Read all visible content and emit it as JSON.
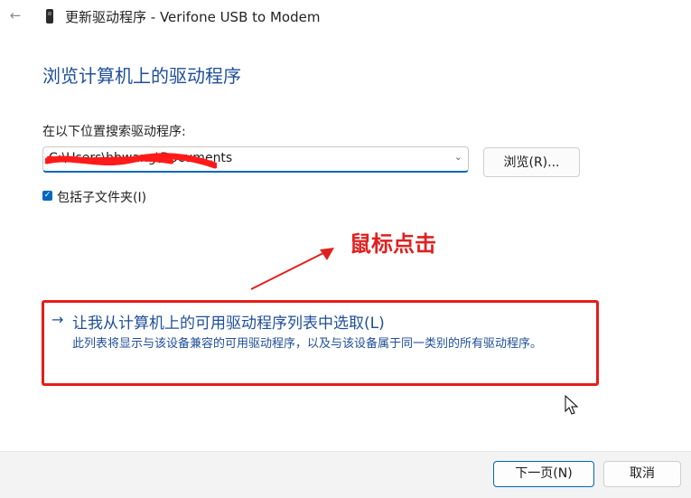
{
  "window": {
    "title": "更新驱动程序 - Verifone USB to Modem",
    "back_icon": "←"
  },
  "page": {
    "heading": "浏览计算机上的驱动程序",
    "search_label": "在以下位置搜索驱动程序:"
  },
  "path_input": {
    "value": "C:\\Users\\hbwang\\Documents",
    "redacted": true,
    "redaction_color": "#ff1a1a"
  },
  "browse_button": {
    "label": "浏览(R)..."
  },
  "include_subfolders": {
    "label": "包括子文件夹(I)",
    "checked": true
  },
  "annotation": {
    "text": "鼠标点击",
    "color": "#e02020"
  },
  "pick_option": {
    "arrow": "→",
    "title": "让我从计算机上的可用驱动程序列表中选取(L)",
    "description": "此列表将显示与该设备兼容的可用驱动程序，以及与该设备属于同一类别的所有驱动程序。",
    "highlight_color": "#e51d1d"
  },
  "footer": {
    "next_label": "下一页(N)",
    "cancel_label": "取消"
  },
  "colors": {
    "accent": "#0067c0",
    "link": "#1f4f98"
  }
}
